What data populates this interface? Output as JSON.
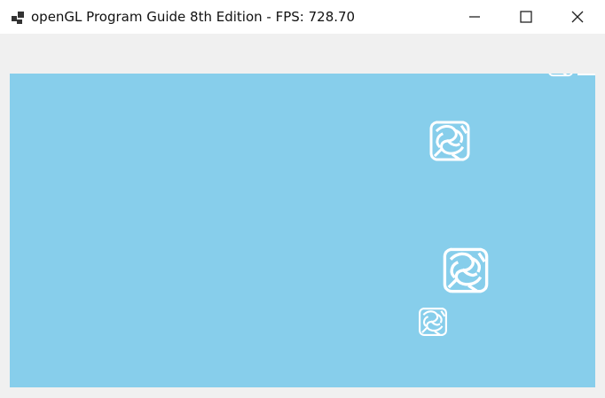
{
  "window": {
    "title": "openGL Program Guide 8th Edition - FPS: 728.70",
    "app_icon": "window-tiles-icon",
    "controls": {
      "minimize_icon": "minimize-icon",
      "maximize_icon": "maximize-icon",
      "close_icon": "close-icon"
    }
  },
  "viewport": {
    "background_color": "#87ceeb",
    "sprite_color": "#ffffff",
    "sprite_icon": "texture-pattern-icon"
  }
}
